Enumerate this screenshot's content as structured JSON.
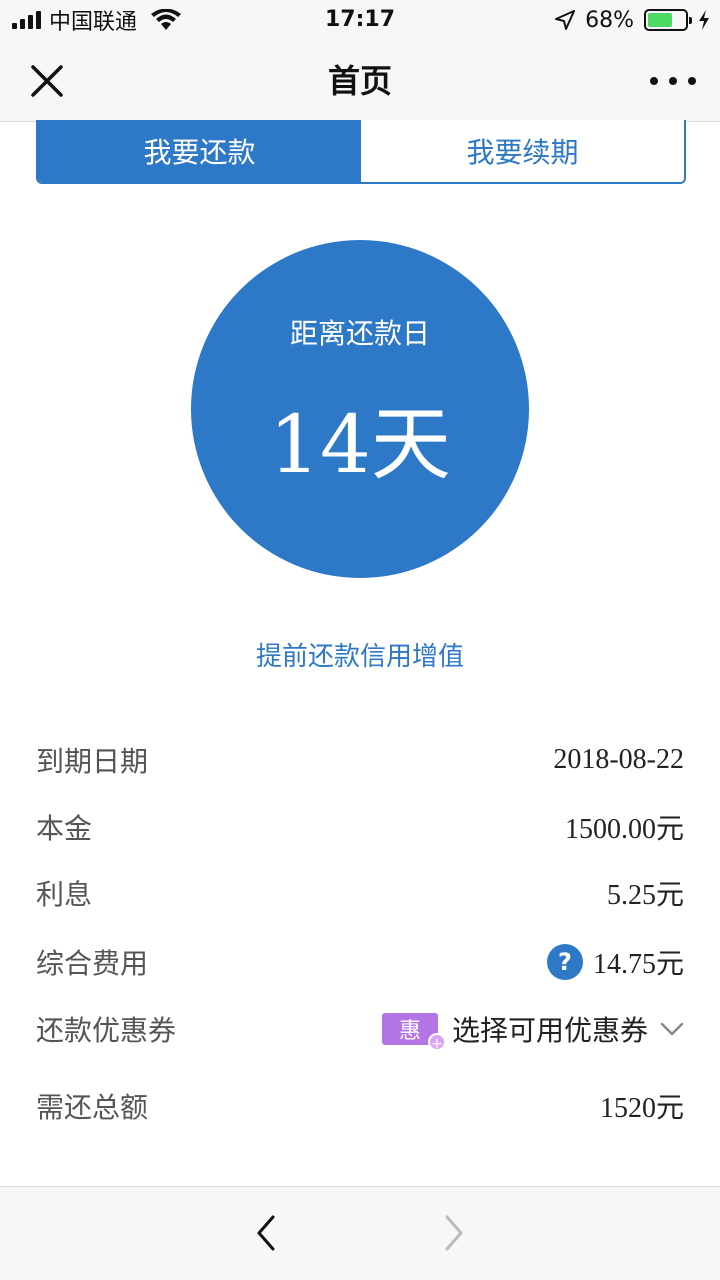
{
  "status_bar": {
    "carrier": "中国联通",
    "time": "17:17",
    "battery_percent": "68%",
    "battery_level": 0.68,
    "icons": [
      "signal-icon",
      "wifi-icon",
      "location-arrow-icon",
      "battery-icon",
      "charging-icon"
    ]
  },
  "nav": {
    "title": "首页",
    "close_icon": "close-icon",
    "more_icon": "more-icon"
  },
  "tabs": [
    {
      "label": "我要还款",
      "active": true
    },
    {
      "label": "我要续期",
      "active": false
    }
  ],
  "countdown": {
    "label": "距离还款日",
    "value": "14天"
  },
  "prepay_link": "提前还款信用增值",
  "details": {
    "due_date": {
      "label": "到期日期",
      "value": "2018-08-22"
    },
    "principal": {
      "label": "本金",
      "value": "1500.00元"
    },
    "interest": {
      "label": "利息",
      "value": "5.25元"
    },
    "fees": {
      "label": "综合费用",
      "value": "14.75元",
      "help_glyph": "?"
    },
    "coupon": {
      "label": "还款优惠券",
      "badge": "惠",
      "badge_plus": "+",
      "select_text": "选择可用优惠券"
    },
    "total": {
      "label": "需还总额",
      "value": "1520元"
    }
  },
  "colors": {
    "primary": "#2e78c8",
    "coupon_badge": "#b374e6",
    "battery_green": "#4cd964"
  }
}
